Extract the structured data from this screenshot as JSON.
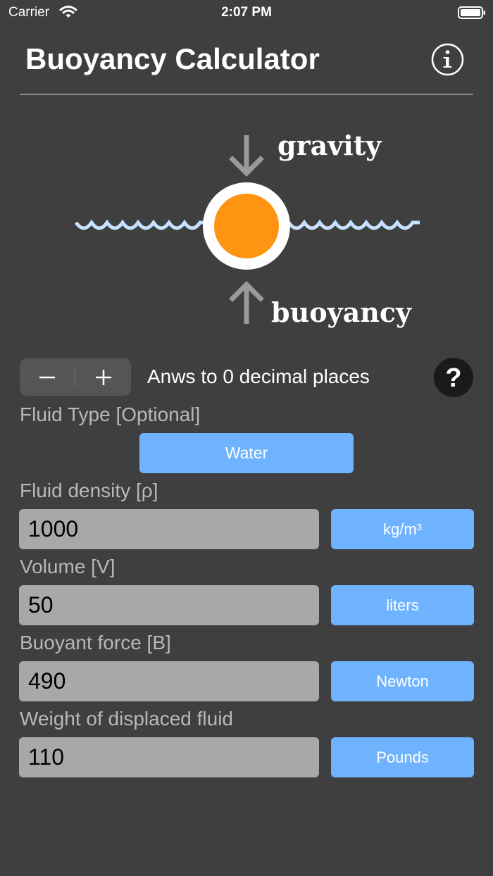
{
  "status_bar": {
    "carrier": "Carrier",
    "time": "2:07 PM",
    "wifi_icon": "wifi-icon",
    "battery_icon": "battery-icon"
  },
  "header": {
    "title": "Buoyancy Calculator",
    "info_icon": "info-icon"
  },
  "diagram": {
    "top_label": "gravity",
    "bottom_label": "buoyancy",
    "ball_color": "#ff9412",
    "water_color": "#c8e1ff",
    "arrow_color": "#9a9a9a"
  },
  "precision": {
    "minus": "−",
    "plus": "+",
    "label": "Anws to 0 decimal places",
    "help": "?"
  },
  "fluid_type": {
    "label": "Fluid Type [Optional]",
    "value": "Water"
  },
  "fields": [
    {
      "label": "Fluid density [ρ]",
      "value": "1000",
      "unit": "kg/m³"
    },
    {
      "label": "Volume [V]",
      "value": "50",
      "unit": "liters"
    },
    {
      "label": "Buoyant force [B]",
      "value": "490",
      "unit": "Newton"
    },
    {
      "label": "Weight of displaced fluid",
      "value": "110",
      "unit": "Pounds"
    }
  ],
  "colors": {
    "background": "#3f3f3f",
    "accent_button": "#6fb3ff",
    "input_background": "#a8a8a8"
  }
}
